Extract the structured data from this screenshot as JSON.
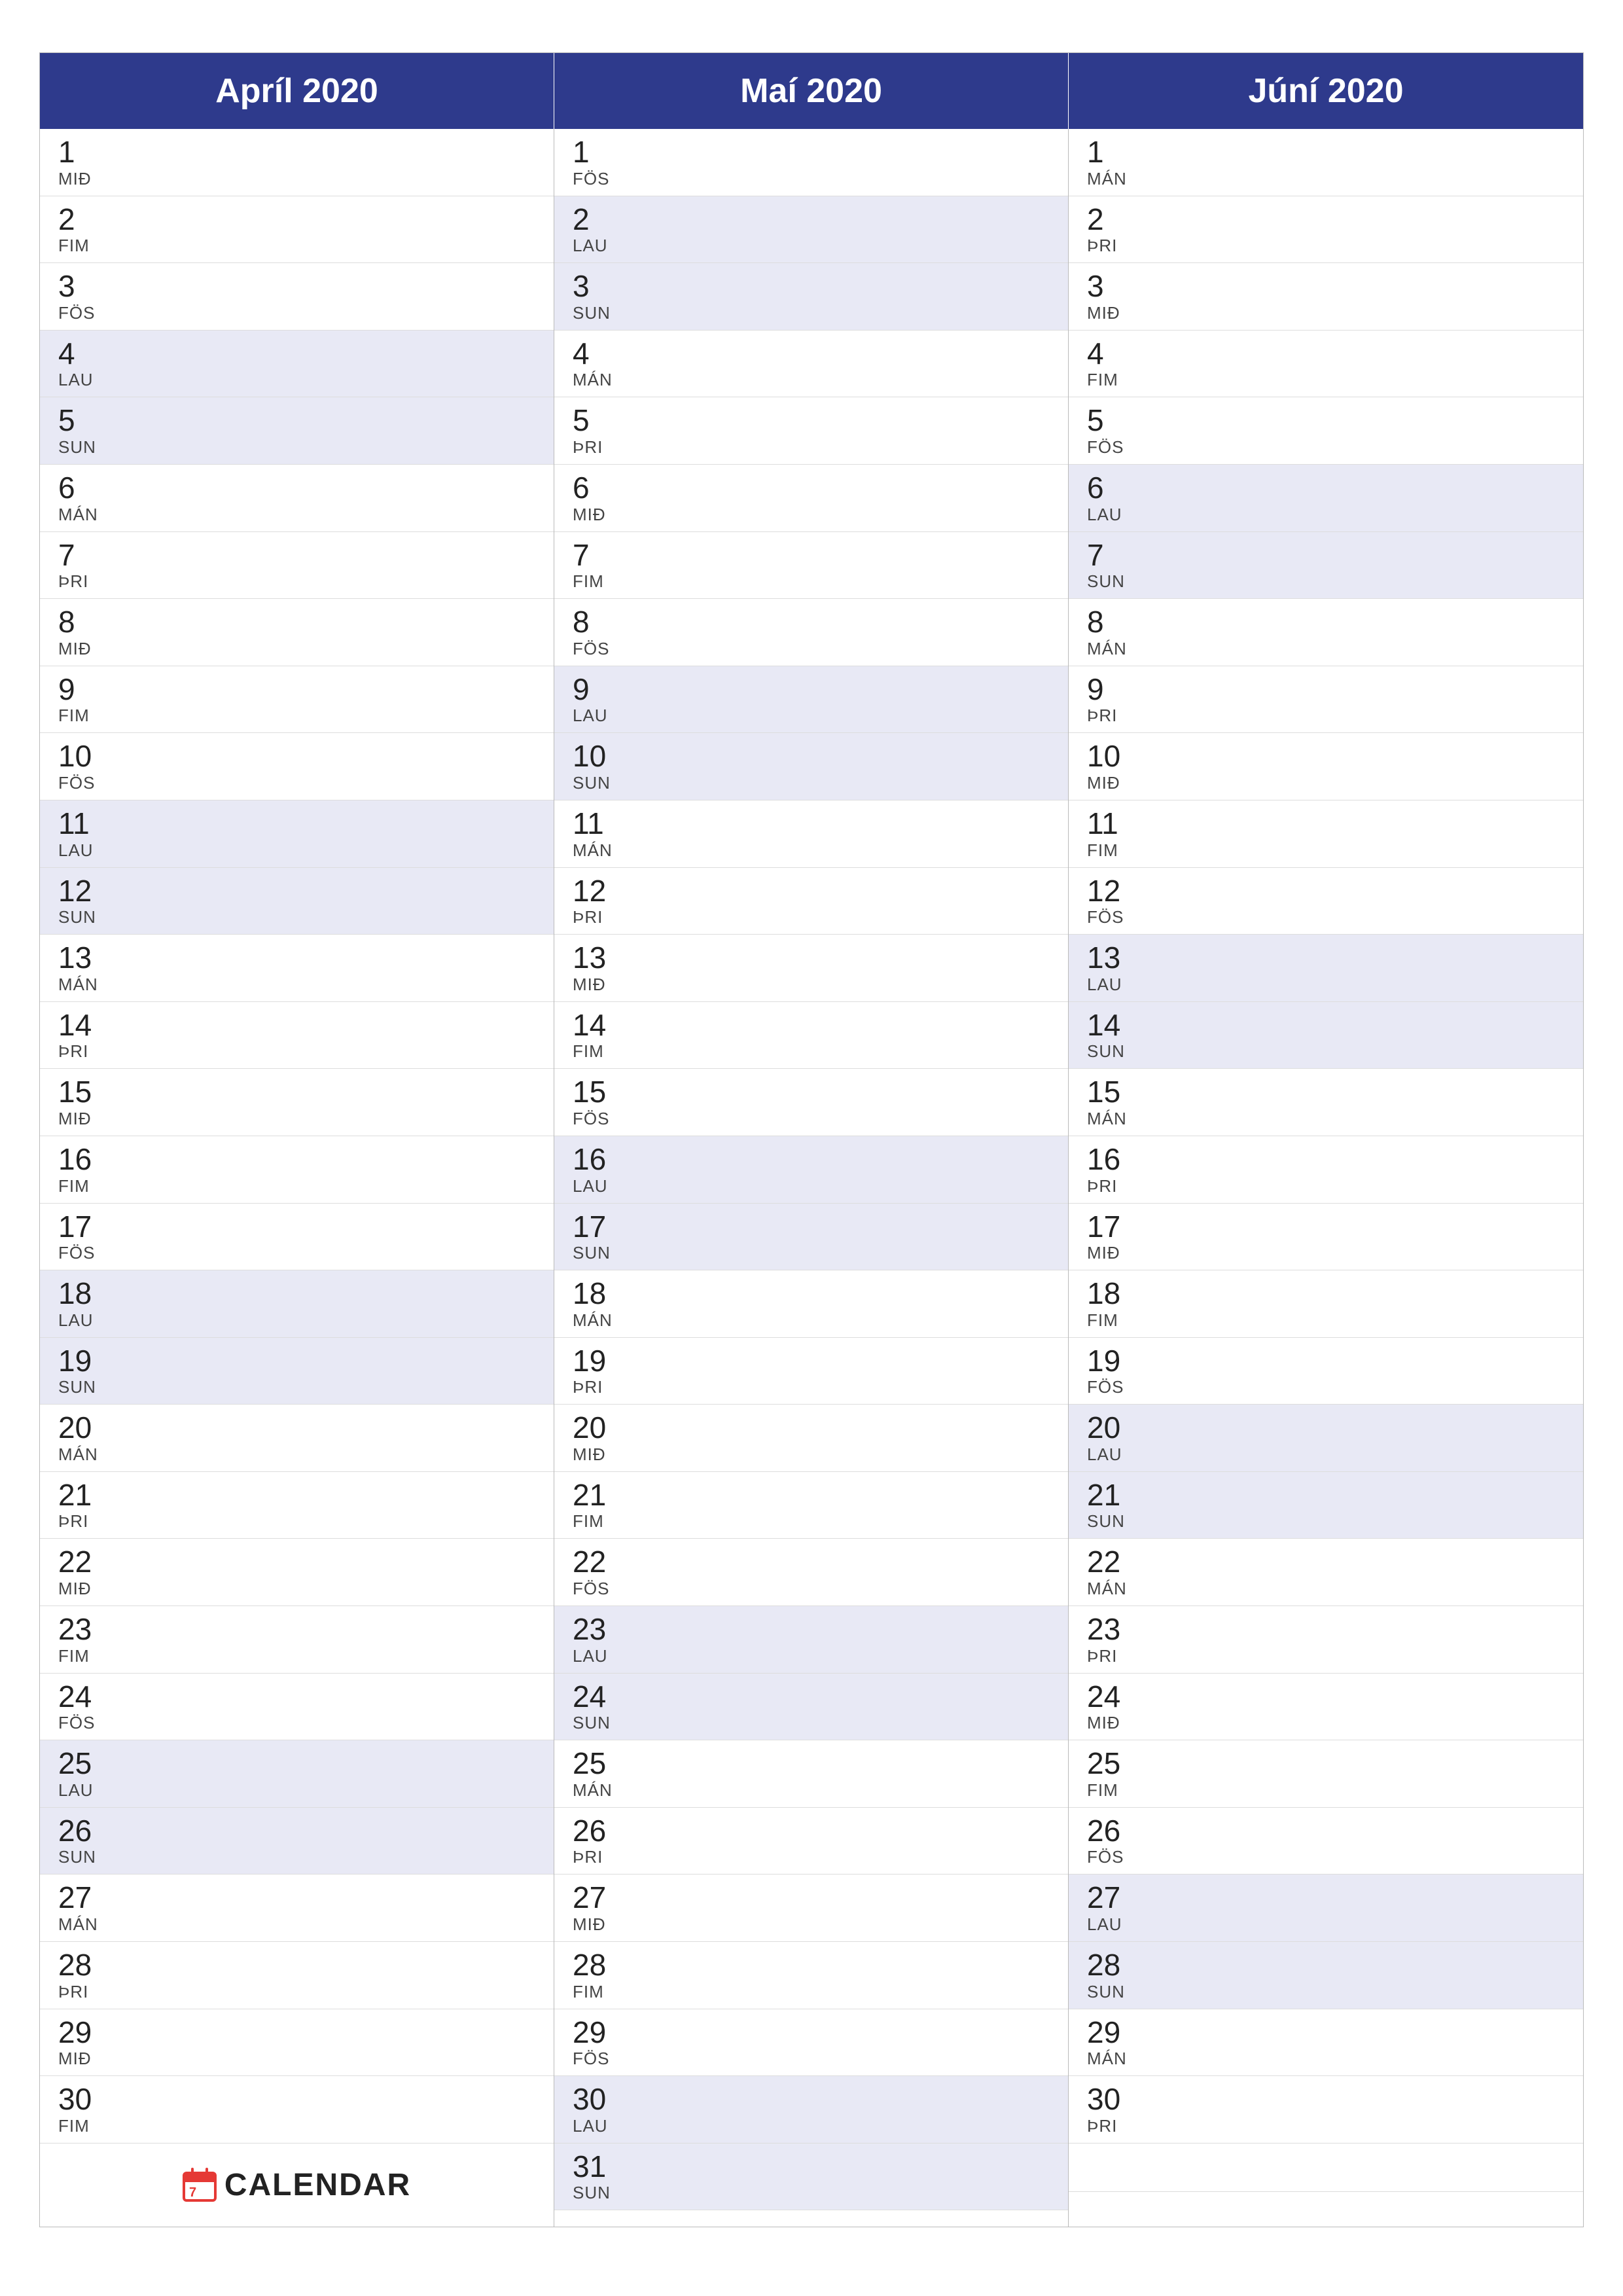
{
  "months": [
    {
      "name": "Apríl 2020",
      "days": [
        {
          "num": "1",
          "day": "MIÐ",
          "weekend": false
        },
        {
          "num": "2",
          "day": "FIM",
          "weekend": false
        },
        {
          "num": "3",
          "day": "FÖS",
          "weekend": false
        },
        {
          "num": "4",
          "day": "LAU",
          "weekend": true
        },
        {
          "num": "5",
          "day": "SUN",
          "weekend": true
        },
        {
          "num": "6",
          "day": "MÁN",
          "weekend": false
        },
        {
          "num": "7",
          "day": "ÞRI",
          "weekend": false
        },
        {
          "num": "8",
          "day": "MIÐ",
          "weekend": false
        },
        {
          "num": "9",
          "day": "FIM",
          "weekend": false
        },
        {
          "num": "10",
          "day": "FÖS",
          "weekend": false
        },
        {
          "num": "11",
          "day": "LAU",
          "weekend": true
        },
        {
          "num": "12",
          "day": "SUN",
          "weekend": true
        },
        {
          "num": "13",
          "day": "MÁN",
          "weekend": false
        },
        {
          "num": "14",
          "day": "ÞRI",
          "weekend": false
        },
        {
          "num": "15",
          "day": "MIÐ",
          "weekend": false
        },
        {
          "num": "16",
          "day": "FIM",
          "weekend": false
        },
        {
          "num": "17",
          "day": "FÖS",
          "weekend": false
        },
        {
          "num": "18",
          "day": "LAU",
          "weekend": true
        },
        {
          "num": "19",
          "day": "SUN",
          "weekend": true
        },
        {
          "num": "20",
          "day": "MÁN",
          "weekend": false
        },
        {
          "num": "21",
          "day": "ÞRI",
          "weekend": false
        },
        {
          "num": "22",
          "day": "MIÐ",
          "weekend": false
        },
        {
          "num": "23",
          "day": "FIM",
          "weekend": false
        },
        {
          "num": "24",
          "day": "FÖS",
          "weekend": false
        },
        {
          "num": "25",
          "day": "LAU",
          "weekend": true
        },
        {
          "num": "26",
          "day": "SUN",
          "weekend": true
        },
        {
          "num": "27",
          "day": "MÁN",
          "weekend": false
        },
        {
          "num": "28",
          "day": "ÞRI",
          "weekend": false
        },
        {
          "num": "29",
          "day": "MIÐ",
          "weekend": false
        },
        {
          "num": "30",
          "day": "FIM",
          "weekend": false
        }
      ],
      "has_logo": true
    },
    {
      "name": "Maí 2020",
      "days": [
        {
          "num": "1",
          "day": "FÖS",
          "weekend": false
        },
        {
          "num": "2",
          "day": "LAU",
          "weekend": true
        },
        {
          "num": "3",
          "day": "SUN",
          "weekend": true
        },
        {
          "num": "4",
          "day": "MÁN",
          "weekend": false
        },
        {
          "num": "5",
          "day": "ÞRI",
          "weekend": false
        },
        {
          "num": "6",
          "day": "MIÐ",
          "weekend": false
        },
        {
          "num": "7",
          "day": "FIM",
          "weekend": false
        },
        {
          "num": "8",
          "day": "FÖS",
          "weekend": false
        },
        {
          "num": "9",
          "day": "LAU",
          "weekend": true
        },
        {
          "num": "10",
          "day": "SUN",
          "weekend": true
        },
        {
          "num": "11",
          "day": "MÁN",
          "weekend": false
        },
        {
          "num": "12",
          "day": "ÞRI",
          "weekend": false
        },
        {
          "num": "13",
          "day": "MIÐ",
          "weekend": false
        },
        {
          "num": "14",
          "day": "FIM",
          "weekend": false
        },
        {
          "num": "15",
          "day": "FÖS",
          "weekend": false
        },
        {
          "num": "16",
          "day": "LAU",
          "weekend": true
        },
        {
          "num": "17",
          "day": "SUN",
          "weekend": true
        },
        {
          "num": "18",
          "day": "MÁN",
          "weekend": false
        },
        {
          "num": "19",
          "day": "ÞRI",
          "weekend": false
        },
        {
          "num": "20",
          "day": "MIÐ",
          "weekend": false
        },
        {
          "num": "21",
          "day": "FIM",
          "weekend": false
        },
        {
          "num": "22",
          "day": "FÖS",
          "weekend": false
        },
        {
          "num": "23",
          "day": "LAU",
          "weekend": true
        },
        {
          "num": "24",
          "day": "SUN",
          "weekend": true
        },
        {
          "num": "25",
          "day": "MÁN",
          "weekend": false
        },
        {
          "num": "26",
          "day": "ÞRI",
          "weekend": false
        },
        {
          "num": "27",
          "day": "MIÐ",
          "weekend": false
        },
        {
          "num": "28",
          "day": "FIM",
          "weekend": false
        },
        {
          "num": "29",
          "day": "FÖS",
          "weekend": false
        },
        {
          "num": "30",
          "day": "LAU",
          "weekend": true
        },
        {
          "num": "31",
          "day": "SUN",
          "weekend": true
        }
      ],
      "has_logo": false
    },
    {
      "name": "Júní 2020",
      "days": [
        {
          "num": "1",
          "day": "MÁN",
          "weekend": false
        },
        {
          "num": "2",
          "day": "ÞRI",
          "weekend": false
        },
        {
          "num": "3",
          "day": "MIÐ",
          "weekend": false
        },
        {
          "num": "4",
          "day": "FIM",
          "weekend": false
        },
        {
          "num": "5",
          "day": "FÖS",
          "weekend": false
        },
        {
          "num": "6",
          "day": "LAU",
          "weekend": true
        },
        {
          "num": "7",
          "day": "SUN",
          "weekend": true
        },
        {
          "num": "8",
          "day": "MÁN",
          "weekend": false
        },
        {
          "num": "9",
          "day": "ÞRI",
          "weekend": false
        },
        {
          "num": "10",
          "day": "MIÐ",
          "weekend": false
        },
        {
          "num": "11",
          "day": "FIM",
          "weekend": false
        },
        {
          "num": "12",
          "day": "FÖS",
          "weekend": false
        },
        {
          "num": "13",
          "day": "LAU",
          "weekend": true
        },
        {
          "num": "14",
          "day": "SUN",
          "weekend": true
        },
        {
          "num": "15",
          "day": "MÁN",
          "weekend": false
        },
        {
          "num": "16",
          "day": "ÞRI",
          "weekend": false
        },
        {
          "num": "17",
          "day": "MIÐ",
          "weekend": false
        },
        {
          "num": "18",
          "day": "FIM",
          "weekend": false
        },
        {
          "num": "19",
          "day": "FÖS",
          "weekend": false
        },
        {
          "num": "20",
          "day": "LAU",
          "weekend": true
        },
        {
          "num": "21",
          "day": "SUN",
          "weekend": true
        },
        {
          "num": "22",
          "day": "MÁN",
          "weekend": false
        },
        {
          "num": "23",
          "day": "ÞRI",
          "weekend": false
        },
        {
          "num": "24",
          "day": "MIÐ",
          "weekend": false
        },
        {
          "num": "25",
          "day": "FIM",
          "weekend": false
        },
        {
          "num": "26",
          "day": "FÖS",
          "weekend": false
        },
        {
          "num": "27",
          "day": "LAU",
          "weekend": true
        },
        {
          "num": "28",
          "day": "SUN",
          "weekend": true
        },
        {
          "num": "29",
          "day": "MÁN",
          "weekend": false
        },
        {
          "num": "30",
          "day": "ÞRI",
          "weekend": false
        }
      ],
      "has_logo": false
    }
  ],
  "logo": {
    "text": "CALENDAR"
  }
}
